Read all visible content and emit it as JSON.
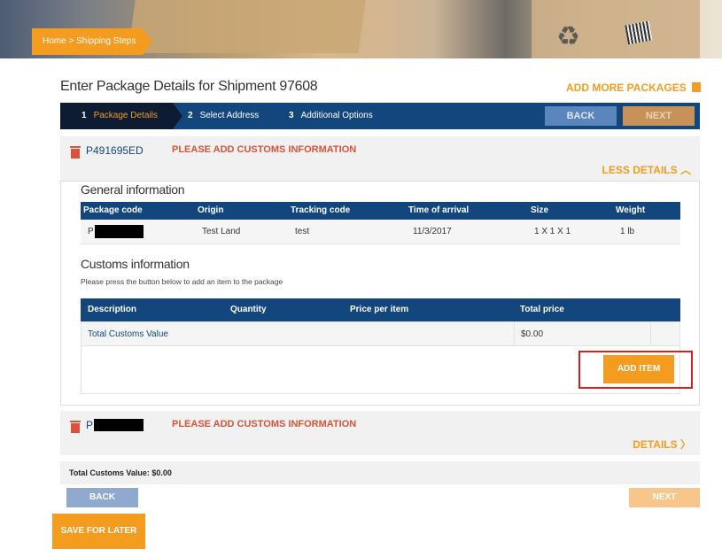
{
  "breadcrumb": {
    "home": "Home",
    "separator": ">",
    "current": "Shipping Steps"
  },
  "page_title": "Enter Package Details for Shipment 97608",
  "add_more_label": "ADD MORE PACKAGES",
  "stepper": {
    "steps": [
      {
        "num": "1",
        "label": "Package Details"
      },
      {
        "num": "2",
        "label": "Select Address"
      },
      {
        "num": "3",
        "label": "Additional Options"
      }
    ],
    "back_label": "BACK",
    "next_label": "NEXT"
  },
  "packages": [
    {
      "code": "P491695ED",
      "warning": "PLEASE ADD CUSTOMS INFORMATION",
      "toggle": "LESS DETAILS"
    },
    {
      "code": "P",
      "warning": "PLEASE ADD CUSTOMS INFORMATION",
      "toggle": "DETAILS"
    }
  ],
  "general": {
    "title": "General information",
    "headers": [
      "Package code",
      "Origin",
      "Tracking code",
      "Time of arrival",
      "Size",
      "Weight"
    ],
    "row": {
      "code": "P",
      "origin": "Test Land",
      "tracking": "test",
      "arrival": "11/3/2017",
      "size": "1 X 1 X 1",
      "weight": "1 lb"
    }
  },
  "customs": {
    "title": "Customs information",
    "note": "Please press the button below to add an item to the package",
    "headers": [
      "Description",
      "Quantity",
      "Price per item",
      "Total price"
    ],
    "total_label": "Total Customs Value",
    "total_value": "$0.00",
    "add_item_label": "ADD ITEM"
  },
  "total_bar": "Total Customs Value: $0.00",
  "bottom": {
    "back_label": "BACK",
    "next_label": "NEXT",
    "save_label": "SAVE FOR LATER"
  },
  "colors": {
    "brand_orange": "#f39c1f",
    "navy": "#14467e",
    "warning_red": "#d9533a"
  }
}
